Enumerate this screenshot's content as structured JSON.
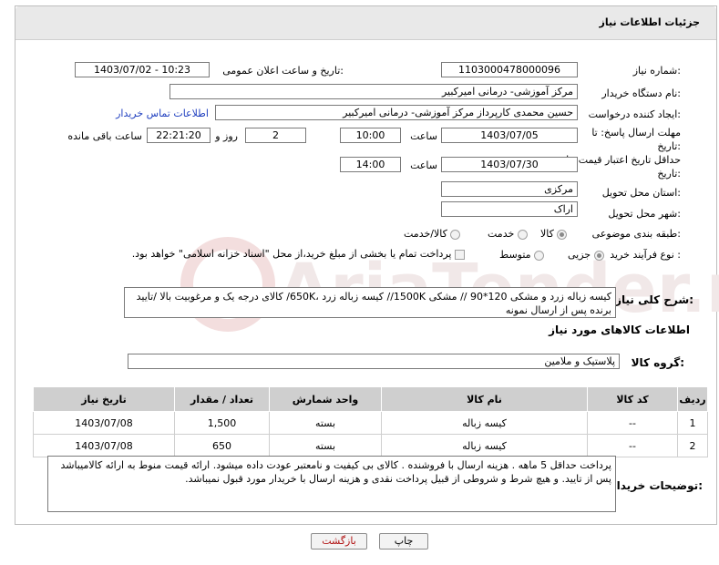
{
  "header": {
    "title": "جزئیات اطلاعات نیاز"
  },
  "need_number": {
    "label": "شماره نیاز:",
    "value": "1103000478000096"
  },
  "announce": {
    "label": "تاریخ و ساعت اعلان عمومی:",
    "value": "1403/07/02 - 10:23"
  },
  "buyer_org": {
    "label": "نام دستگاه خریدار:",
    "value": "مرکز آموزشی- درمانی امیرکبیر"
  },
  "creator": {
    "label": "ایجاد کننده درخواست:",
    "value": "حسین  محمدی کارپرداز مرکز آموزشی- درمانی امیرکبیر",
    "contact_link": "اطلاعات تماس خریدار"
  },
  "deadline": {
    "label": "مهلت ارسال پاسخ: تا تاریخ:",
    "date": "1403/07/05",
    "time_label": "ساعت",
    "time": "10:00",
    "days": "2",
    "days_label": "روز و",
    "remaining": "22:21:20",
    "remaining_label": "ساعت باقی مانده"
  },
  "validity": {
    "label": "حداقل تاریخ اعتبار قیمت: تا تاریخ:",
    "date": "1403/07/30",
    "time_label": "ساعت",
    "time": "14:00"
  },
  "province": {
    "label": "استان محل تحویل:",
    "value": "مرکزی"
  },
  "city": {
    "label": "شهر محل تحویل:",
    "value": "اراک"
  },
  "category": {
    "label": "طبقه بندی موضوعی:",
    "options": [
      "کالا",
      "خدمت",
      "کالا/خدمت"
    ],
    "selected": "کالا"
  },
  "process": {
    "label": "نوع فرآیند خرید :",
    "options": [
      "جزیی",
      "متوسط"
    ],
    "selected": "جزیی",
    "payment_note": "پرداخت تمام یا بخشی از مبلغ خرید،از محل \"اسناد خزانه اسلامی\" خواهد بود."
  },
  "summary": {
    "label": "شرح کلی نیاز:",
    "text": "کیسه زباله زرد  و مشکی 120*90   // مشکی 1500K// کیسه زباله زرد ،650K/ کالای درجه یک و مرغوبیت بالا /تایید برنده پس از  ارسال نمونه"
  },
  "goods_section": {
    "title": "اطلاعات کالاهای مورد نیاز"
  },
  "goods_group": {
    "label": "گروه کالا:",
    "value": "پلاستیک و ملامین"
  },
  "table": {
    "headers": [
      "ردیف",
      "کد کالا",
      "نام کالا",
      "واحد شمارش",
      "تعداد / مقدار",
      "تاریخ نیاز"
    ],
    "rows": [
      [
        "1",
        "--",
        "کیسه زباله",
        "بسته",
        "1,500",
        "1403/07/08"
      ],
      [
        "2",
        "--",
        "کیسه زباله",
        "بسته",
        "650",
        "1403/07/08"
      ]
    ]
  },
  "buyer_notes": {
    "label": "توضیحات خریدار:",
    "text": "پرداخت حداقل 5 ماهه . هزینه ارسال با فروشنده .  کالای بی کیفیت و نامعتبر عودت داده میشود. ارائه قیمت منوط به ارائه کالامیباشد پس از تایید. و هیچ شرط و شروطی از قبیل پرداخت نقدی و هزینه ارسال با خریدار مورد قبول نمیباشد."
  },
  "buttons": {
    "print": "چاپ",
    "back": "بازگشت"
  },
  "colors": {
    "link": "#1f3fbf",
    "header_bg": "#e9e9e9",
    "table_header": "#cfcfcf",
    "back_button_text": "#b01010"
  }
}
